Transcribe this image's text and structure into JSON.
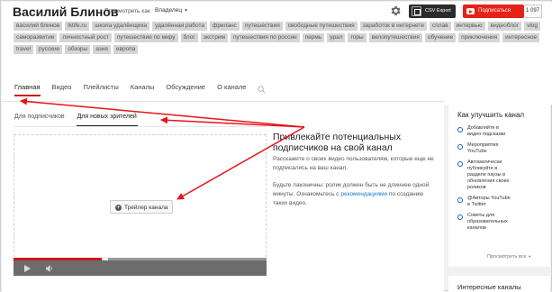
{
  "header": {
    "channel_name": "Василий Блинов",
    "view_as_label": "Просмотреть как",
    "view_as_value": "Владелец",
    "csv_export": "CSV Export",
    "subscribe_label": "Подписаться",
    "subscriber_count": "1 097"
  },
  "tags": [
    "василий блинов",
    "lktife.ru",
    "школа удалёнщика",
    "удалённая работа",
    "фриланс",
    "путешествия",
    "свободные путешествия",
    "заработок в интернете",
    "сплав",
    "интервью",
    "видеоблог",
    "vlog",
    "саморазвитие",
    "личностный рост",
    "путешествие по миру",
    "блог",
    "экстрим",
    "путешествия по россии",
    "пермь",
    "урал",
    "горы",
    "велопутешествия",
    "обучение",
    "приключения",
    "интересное",
    "travel",
    "русские",
    "обзоры",
    "азия",
    "европа"
  ],
  "tabs": [
    {
      "label": "Главная",
      "active": true
    },
    {
      "label": "Видео",
      "active": false
    },
    {
      "label": "Плейлисты",
      "active": false
    },
    {
      "label": "Каналы",
      "active": false
    },
    {
      "label": "Обсуждение",
      "active": false
    },
    {
      "label": "О канале",
      "active": false
    }
  ],
  "search_icon": "search-icon",
  "subtabs": [
    {
      "label": "Для подписчиков",
      "active": false
    },
    {
      "label": "Для новых зрителей",
      "active": true
    }
  ],
  "player": {
    "trailer_button": "Трейлер канала",
    "progress_fraction": 0.36
  },
  "promo": {
    "title": "Привлекайте потенциальных подписчиков на свой канал",
    "p1": "Расскажите о своих видео пользователям, которые еще не подписались на ваш канал.",
    "p2_before": "Будьте лаконичны: ролик должен быть не длиннее одной минуты. Ознакомьтесь с ",
    "p2_link": "рекомендациями",
    "p2_after": " по созданию таких видео."
  },
  "sidebar": {
    "title": "Как улучшить канал",
    "items": [
      "Добавляйте в видео подсказки",
      "Мероприятия YouTube",
      "Автоматически публикуйте в разделе паузы в обновления своих роликов",
      "@Авторы YouTube в Twitter",
      "Советы для образовательных каналов"
    ],
    "see_all": "Просмотреть все"
  },
  "sidebar2": {
    "title": "Интересные каналы"
  },
  "colors": {
    "accent_red": "#cc181e",
    "annotation_red": "#e8141a",
    "link_blue": "#167ac6"
  }
}
